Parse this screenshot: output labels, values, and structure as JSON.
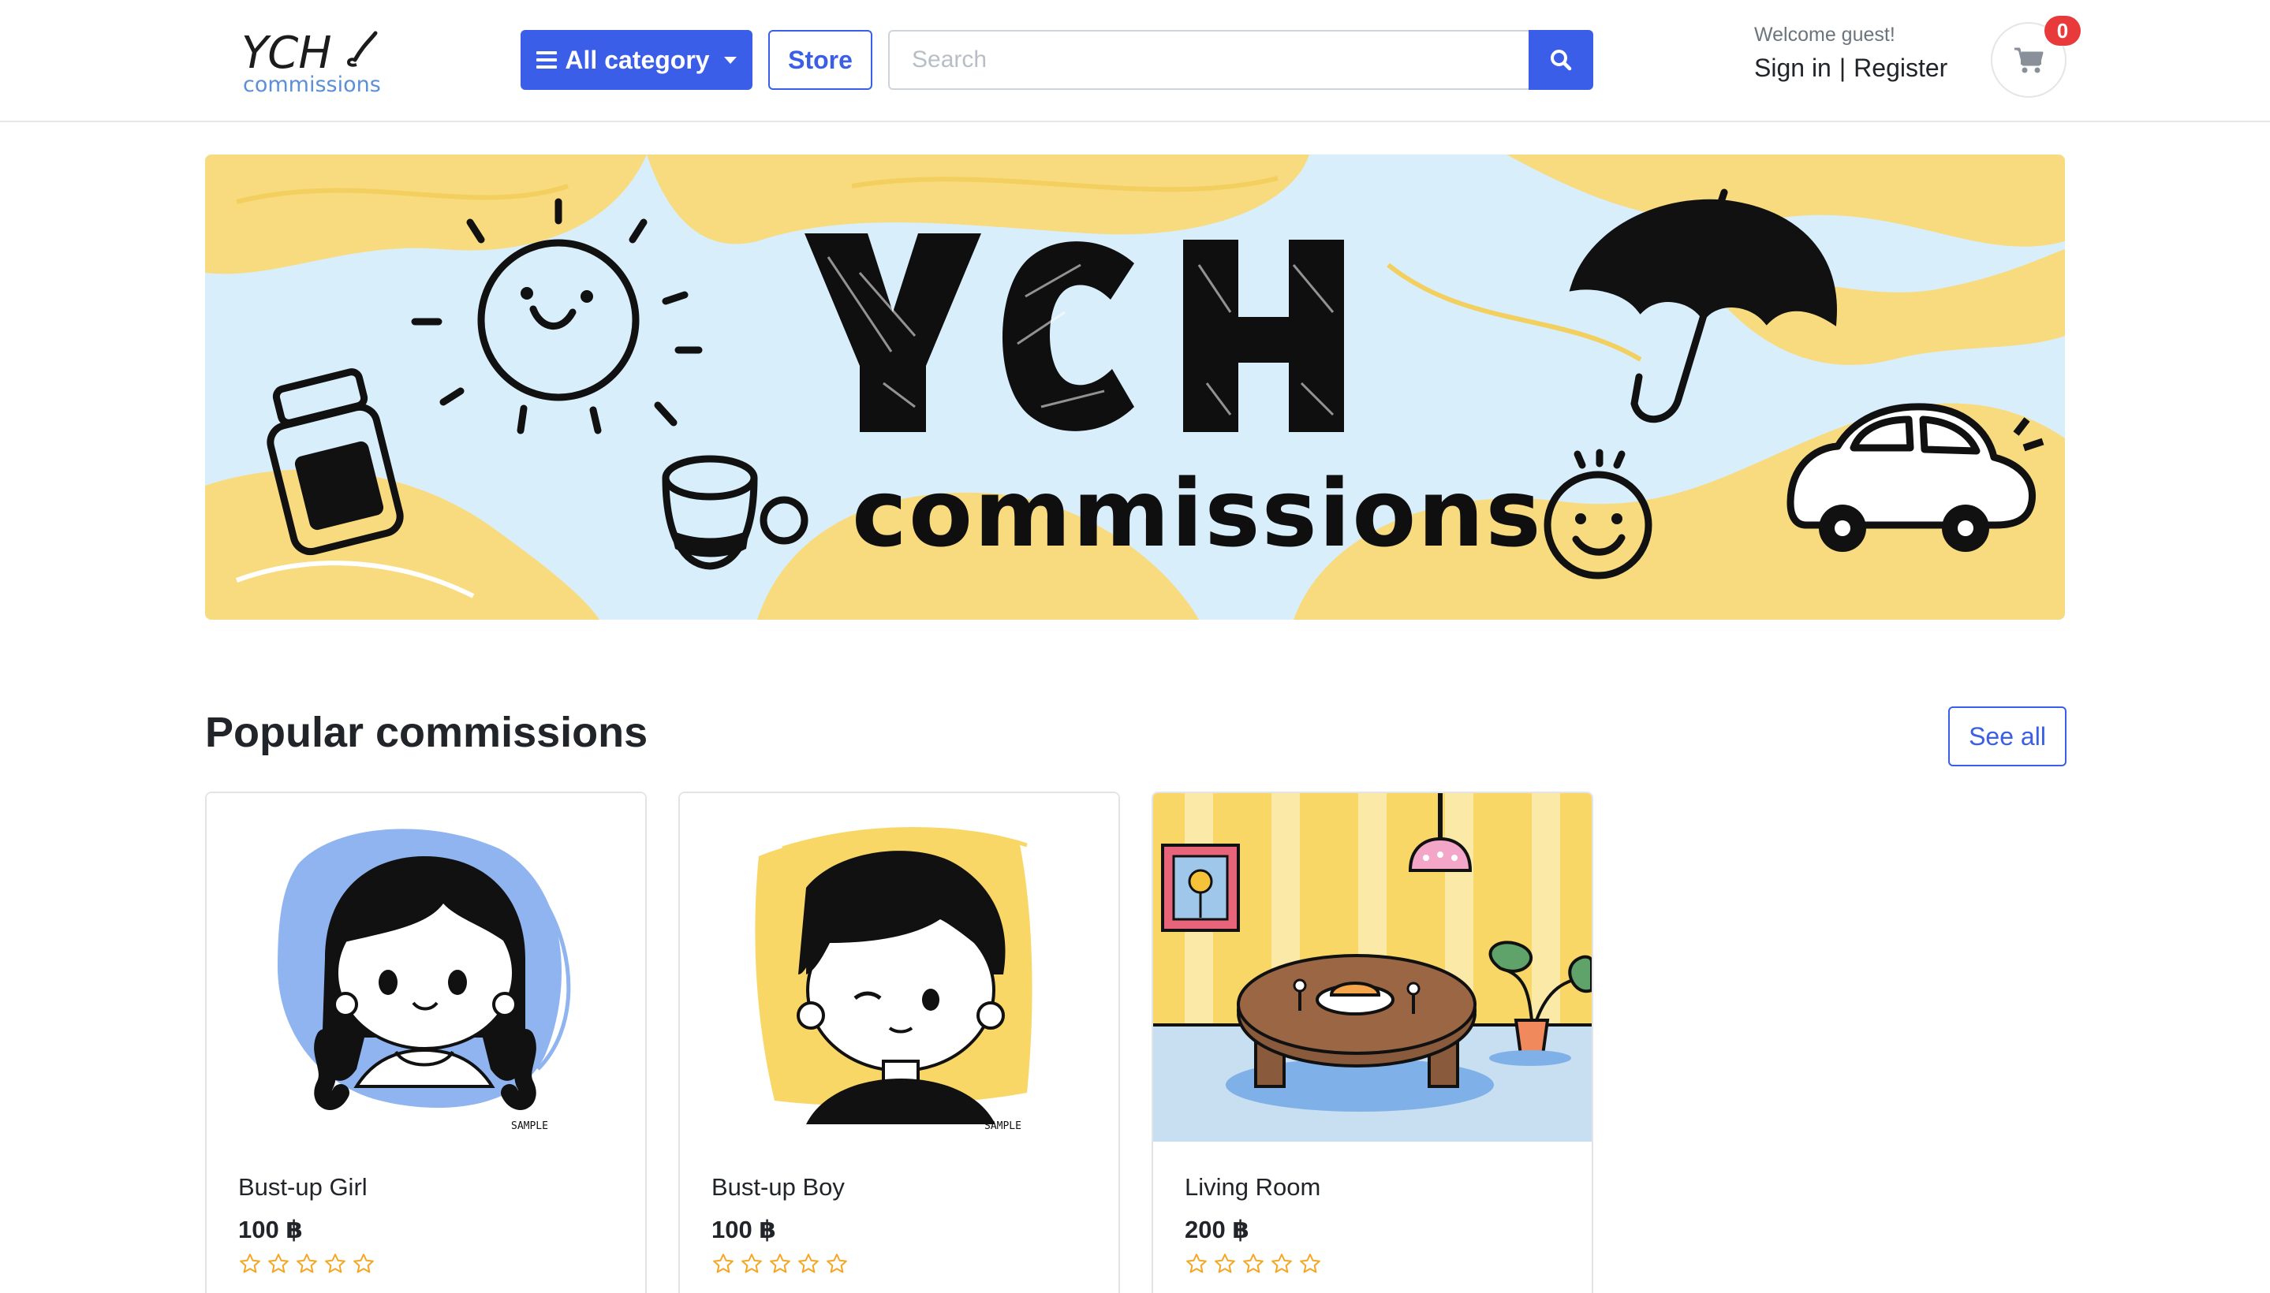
{
  "header": {
    "logo_main": "YCH",
    "logo_sub": "commissions",
    "category_label": "All category",
    "store_label": "Store",
    "search_placeholder": "Search",
    "welcome": "Welcome guest!",
    "sign_in": "Sign in",
    "separator": "|",
    "register": "Register",
    "cart_count": "0"
  },
  "banner": {
    "title": "YCH",
    "subtitle": "commissions"
  },
  "section": {
    "title": "Popular commissions",
    "see_all": "See all"
  },
  "products": [
    {
      "name": "Bust-up Girl",
      "price": "100 ฿",
      "rating": 0,
      "watermark": "SAMPLE"
    },
    {
      "name": "Bust-up Boy",
      "price": "100 ฿",
      "rating": 0,
      "watermark": "SAMPLE"
    },
    {
      "name": "Living Room",
      "price": "200 ฿",
      "rating": 0
    }
  ],
  "colors": {
    "primary": "#3b5ee8",
    "badge": "#e83a3a",
    "banner_blue": "#d9eefb",
    "banner_yellow": "#f8db7f",
    "star": "#f5a623"
  }
}
